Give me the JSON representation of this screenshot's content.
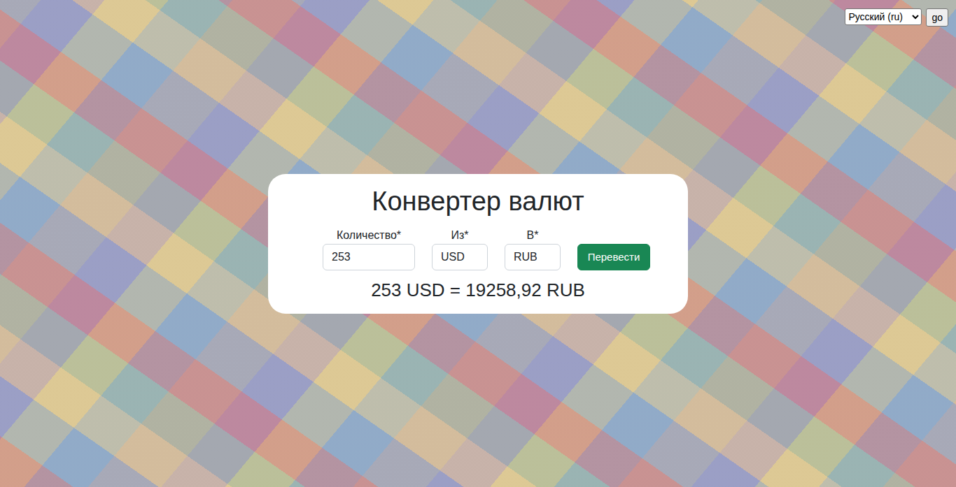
{
  "language": {
    "value": "Русский (ru)",
    "button": "go"
  },
  "converter": {
    "title": "Конвертер валют",
    "fields": [
      {
        "label": "Количество*",
        "value": "253",
        "kind": "wide"
      },
      {
        "label": "Из*",
        "value": "USD",
        "kind": "narrow"
      },
      {
        "label": "В*",
        "value": "RUB",
        "kind": "narrow"
      }
    ],
    "button": "Перевести",
    "result": "253 USD = 19258,92 RUB"
  }
}
